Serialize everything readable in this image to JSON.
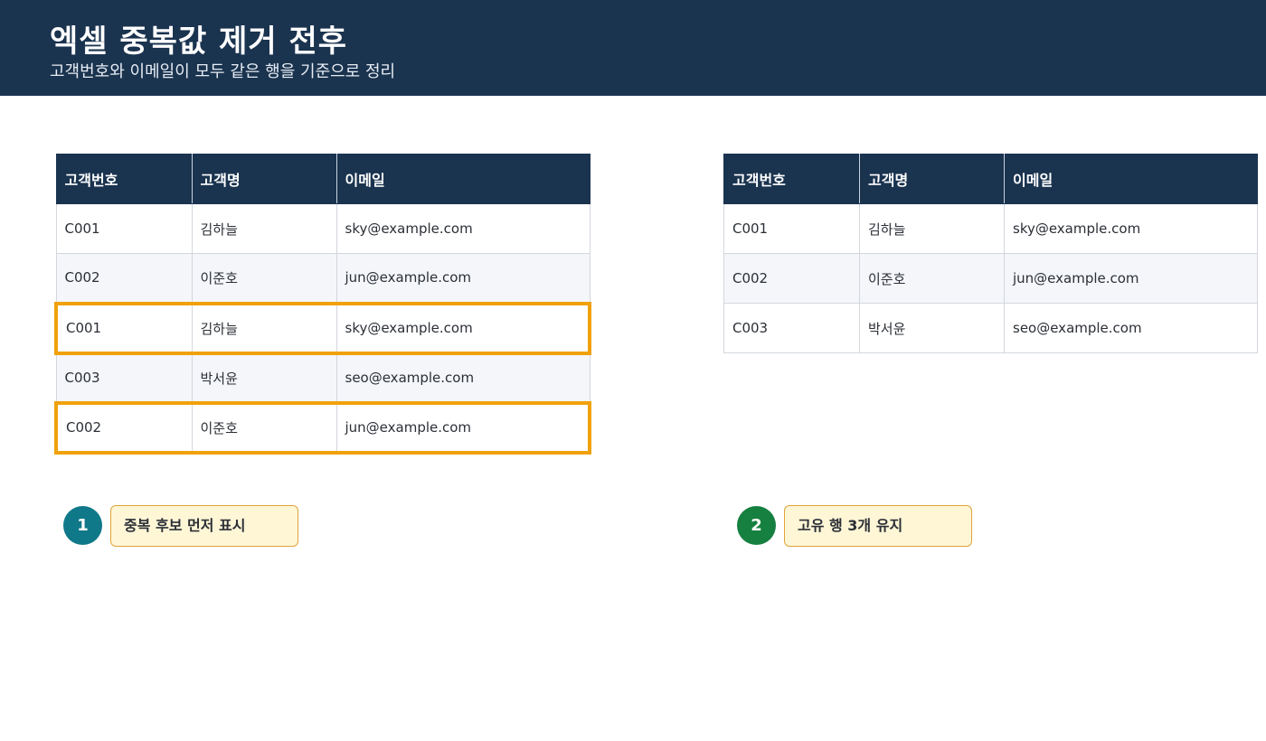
{
  "header": {
    "title": "엑셀 중복값 제거 전후",
    "subtitle": "고객번호와 이메일이 모두 같은 행을 기준으로 정리"
  },
  "colors": {
    "header_bg": "#1a334f",
    "highlight": "#f0a10c",
    "note_bg": "#fff6d6",
    "badge1": "#0f7889",
    "badge2": "#168040"
  },
  "before_table": {
    "columns": [
      "고객번호",
      "고객명",
      "이메일"
    ],
    "rows": [
      {
        "id": "C001",
        "name": "김하늘",
        "email": "sky@example.com",
        "duplicate": false
      },
      {
        "id": "C002",
        "name": "이준호",
        "email": "jun@example.com",
        "duplicate": false
      },
      {
        "id": "C001",
        "name": "김하늘",
        "email": "sky@example.com",
        "duplicate": true
      },
      {
        "id": "C003",
        "name": "박서윤",
        "email": "seo@example.com",
        "duplicate": false
      },
      {
        "id": "C002",
        "name": "이준호",
        "email": "jun@example.com",
        "duplicate": true
      }
    ]
  },
  "after_table": {
    "columns": [
      "고객번호",
      "고객명",
      "이메일"
    ],
    "rows": [
      {
        "id": "C001",
        "name": "김하늘",
        "email": "sky@example.com"
      },
      {
        "id": "C002",
        "name": "이준호",
        "email": "jun@example.com"
      },
      {
        "id": "C003",
        "name": "박서윤",
        "email": "seo@example.com"
      }
    ]
  },
  "steps": [
    {
      "number": "1",
      "label": "중복 후보 먼저 표시"
    },
    {
      "number": "2",
      "label": "고유 행 3개 유지"
    }
  ]
}
